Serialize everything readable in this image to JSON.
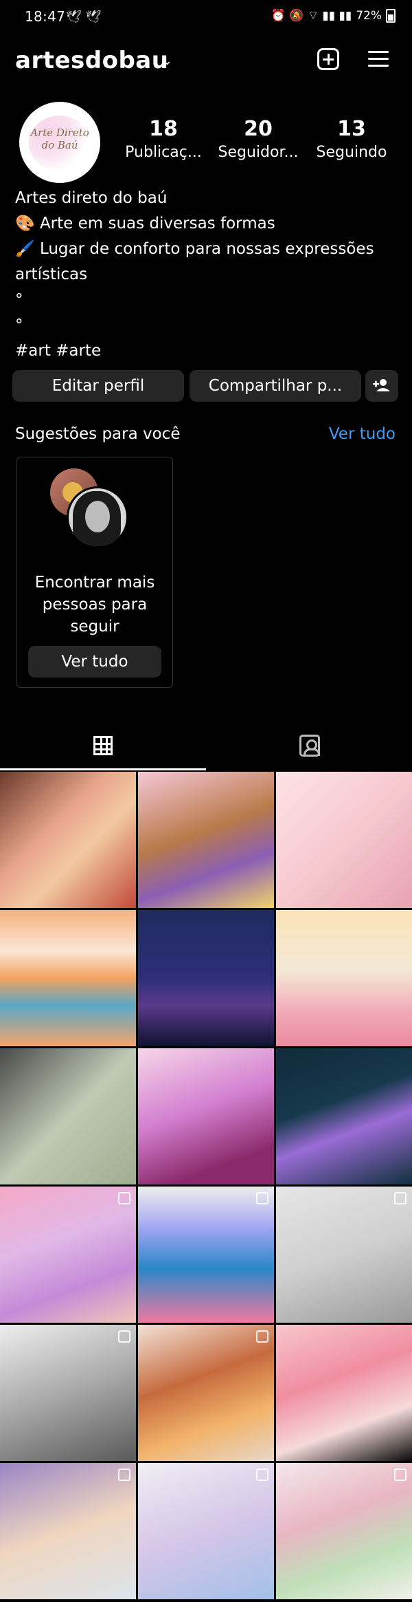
{
  "status_bar": {
    "time": "18:47",
    "battery": "72%"
  },
  "header": {
    "username": "artesdobau"
  },
  "avatar_text": [
    "Arte Direto",
    "do Baú"
  ],
  "stats": [
    {
      "value": "18",
      "label": "Publicaç..."
    },
    {
      "value": "20",
      "label": "Seguidor..."
    },
    {
      "value": "13",
      "label": "Seguindo"
    }
  ],
  "bio": {
    "line1": "Artes direto do baú",
    "line2": "🎨 Arte em suas diversas formas",
    "line3": "🖌️ Lugar de conforto para nossas expressões artísticas",
    "line4": "°",
    "line5": "°",
    "hashtags": "#art #arte"
  },
  "buttons": {
    "edit": "Editar perfil",
    "share": "Compartilhar p..."
  },
  "suggestions": {
    "title": "Sugestões para você",
    "see_all": "Ver tudo",
    "card_text": "Encontrar mais pessoas para seguir",
    "card_button": "Ver tudo"
  },
  "grid": [
    {
      "name": "post-1",
      "bg": "linear-gradient(135deg,#6b3a2a,#e9a68c 40%,#f3c9a2 60%,#c24a3a)",
      "multi": false
    },
    {
      "name": "post-2",
      "bg": "linear-gradient(160deg,#f6c7d6,#b87a4a 45%,#8b5fb4 70%,#f1d36a)",
      "multi": false
    },
    {
      "name": "post-3",
      "bg": "linear-gradient(135deg,#fbe3e5,#f7c9cf 50%,#e7a3b1)",
      "multi": false
    },
    {
      "name": "post-4",
      "bg": "linear-gradient(180deg,#f6b27e 0%,#fbe7d6 30%,#f3a25f 50%,#5aa7c6 70%,#f5a56a)",
      "multi": false
    },
    {
      "name": "post-5",
      "bg": "linear-gradient(180deg,#1f2a5c,#2d2f7a 50%,#5b3a8a 70%,#0f1233)",
      "multi": false
    },
    {
      "name": "post-6",
      "bg": "linear-gradient(180deg,#fbe3b8,#f4e8d5 45%,#f2a9b8 75%,#e98a9d)",
      "multi": false
    },
    {
      "name": "post-7",
      "bg": "linear-gradient(135deg,#4a4a4a,#bfc9b4 50%,#a1ad90)",
      "multi": false
    },
    {
      "name": "post-8",
      "bg": "linear-gradient(160deg,#f6d6e8,#d27ed0 45%,#8b2a6a 80%)",
      "multi": false
    },
    {
      "name": "post-9",
      "bg": "linear-gradient(160deg,#102a3a,#16394c 40%,#9a6cd6 60%,#12303f)",
      "multi": false
    },
    {
      "name": "post-10",
      "bg": "linear-gradient(160deg,#f6a9c8,#e0b8e6 40%,#c58ad8 70%,#f2c5b8)",
      "multi": true
    },
    {
      "name": "post-11",
      "bg": "linear-gradient(180deg,#ededed,#a3a7f2 30%,#2a87c8 60%,#f07aa2)",
      "multi": true
    },
    {
      "name": "post-12",
      "bg": "linear-gradient(160deg,#e6e6e6,#cfcfcf 50%,#9a9a9a)",
      "multi": true
    },
    {
      "name": "post-13",
      "bg": "linear-gradient(160deg,#eeeeee,#a8a8a8 50%,#5a5a5a)",
      "multi": true
    },
    {
      "name": "post-14",
      "bg": "linear-gradient(160deg,#f3e2d6,#c66a3e 40%,#f2b36a 70%,#e7d7c8)",
      "multi": true
    },
    {
      "name": "post-15",
      "bg": "linear-gradient(160deg,#f8c6cc,#f08ea0 40%,#f6dada 70%,#0a0a0a)",
      "multi": false
    },
    {
      "name": "post-16",
      "bg": "linear-gradient(160deg,#9a86c6,#f0d6c0 50%,#dce4ec)",
      "multi": true
    },
    {
      "name": "post-17",
      "bg": "linear-gradient(160deg,#f1eef4,#d6c6e8 50%,#a3c0e8)",
      "multi": true
    },
    {
      "name": "post-18",
      "bg": "linear-gradient(160deg,#f4e8ec,#e8b6c4 40%,#bfe0b8 70%,#f1f0ea)",
      "multi": true
    }
  ]
}
